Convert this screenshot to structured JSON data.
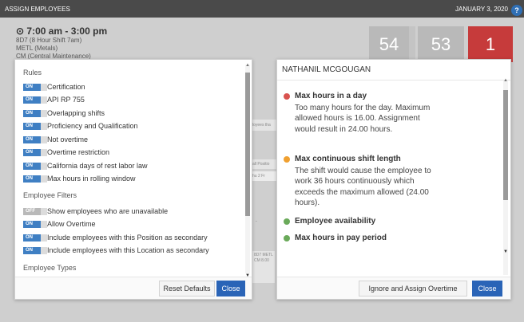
{
  "topbar": {
    "title": "ASSIGN EMPLOYEES",
    "date": "JANUARY 3, 2020",
    "help": "?"
  },
  "shift": {
    "time": "7:00 am - 3:00 pm",
    "lines": [
      "8D7 (8 Hour Shift 7am)",
      "METL (Metals)",
      "CM (Central Maintenance)"
    ]
  },
  "counters": {
    "a": "54",
    "b": "53",
    "c": "1"
  },
  "background": {
    "employees_text": "loyees tha",
    "position_text": "all Positio",
    "days_text": "hu 2   Fr",
    "dash": "-",
    "cell_text": "8D7 METL CM 8.00"
  },
  "left_panel": {
    "rules_heading": "Rules",
    "rules": [
      {
        "toggle": "ON",
        "label": "Certification"
      },
      {
        "toggle": "ON",
        "label": "API RP 755"
      },
      {
        "toggle": "ON",
        "label": "Overlapping shifts"
      },
      {
        "toggle": "ON",
        "label": "Proficiency and Qualification"
      },
      {
        "toggle": "ON",
        "label": "Not overtime"
      },
      {
        "toggle": "ON",
        "label": "Overtime restriction"
      },
      {
        "toggle": "ON",
        "label": "California days of rest labor law"
      },
      {
        "toggle": "ON",
        "label": "Max hours in rolling window"
      }
    ],
    "filters_heading": "Employee Filters",
    "filters": [
      {
        "toggle": "OFF",
        "label": "Show employees who are unavailable"
      },
      {
        "toggle": "ON",
        "label": "Allow Overtime"
      },
      {
        "toggle": "ON",
        "label": "Include employees with this Position as secondary"
      },
      {
        "toggle": "ON",
        "label": "Include employees with this Location as secondary"
      }
    ],
    "types_heading": "Employee Types",
    "reset_label": "Reset Defaults",
    "close_label": "Close"
  },
  "right_panel": {
    "employee_name": "NATHANIL MCGOUGAN",
    "issues": [
      {
        "title": "Max hours in a day",
        "status_color": "#d9534f",
        "description": "Too many hours for the day. Maximum allowed hours is 16.00. Assignment would result in 24.00 hours."
      },
      {
        "title": "Max continuous shift length",
        "status_color": "#f0a030",
        "description": "The shift would cause the employee to work 36 hours continuously which exceeds the maximum allowed (24.00 hours)."
      },
      {
        "title": "Employee availability",
        "status_color": "#6aaa5a",
        "description": ""
      },
      {
        "title": "Max hours in pay period",
        "status_color": "#6aaa5a",
        "description": ""
      }
    ],
    "ignore_label": "Ignore and Assign Overtime",
    "close_label": "Close"
  },
  "colors": {
    "primary": "#2a64b7",
    "toggle_on": "#3f7fc3",
    "alert": "#c63b3b",
    "topbar": "#4a4a4a"
  }
}
